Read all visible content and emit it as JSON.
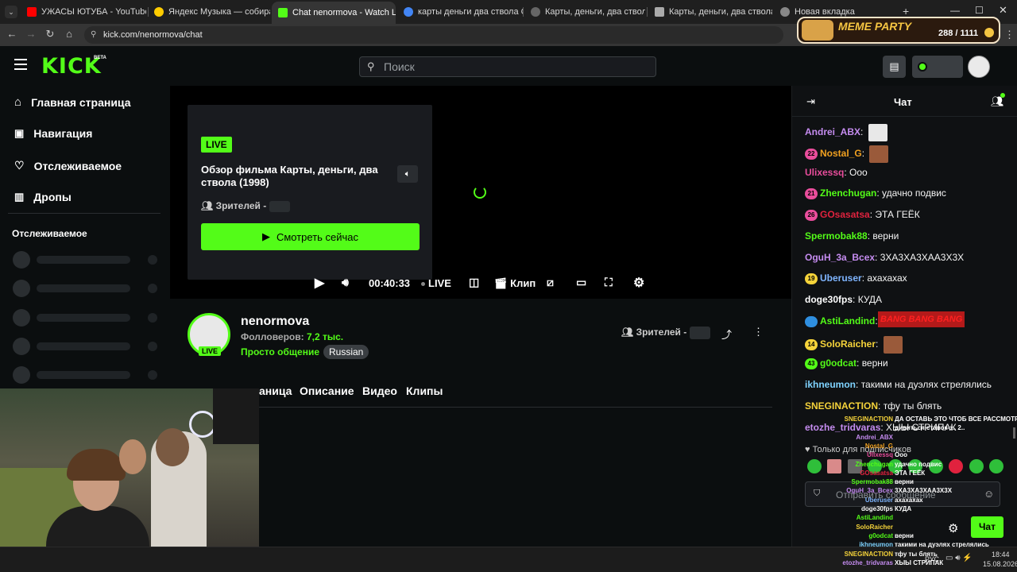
{
  "browser": {
    "tabs": [
      {
        "label": "УЖАСЫ ЮТУБА - YouTube",
        "color": "#ff0000"
      },
      {
        "label": "Яндекс Музыка — собираем...",
        "color": "#ffcc00"
      },
      {
        "label": "Chat nenormova - Watch Live o...",
        "color": "#53fc18"
      },
      {
        "label": "карты деньги два ствола СМО...",
        "color": "#4285f4"
      },
      {
        "label": "Карты, деньги, два ствола фи...",
        "color": "#888888"
      },
      {
        "label": "Карты, деньги, два ствола (199...",
        "color": "#aaaaaa"
      },
      {
        "label": "Новая вкладка",
        "color": "#888888"
      }
    ],
    "url": "kick.com/nenormova/chat"
  },
  "meme_party": {
    "title": "MEME PARTY",
    "count": "288 / 1111"
  },
  "header": {
    "logo": "KICK",
    "beta": "BETA",
    "search_placeholder": "Поиск"
  },
  "sidebar": {
    "items": [
      {
        "label": "Главная страница"
      },
      {
        "label": "Навигация"
      },
      {
        "label": "Отслеживаемое"
      },
      {
        "label": "Дропы"
      }
    ],
    "section_title": "Отслеживаемое"
  },
  "player": {
    "live": "LIVE",
    "title": "Обзор фильма Карты, деньги, два ствола (1998)",
    "viewers_label": "Зрителей -",
    "watch_now": "Смотреть сейчас",
    "time": "00:40:33",
    "live_ctrl": "LIVE",
    "clip": "Клип"
  },
  "channel": {
    "name": "nenormova",
    "followers_label": "Фолловеров:",
    "followers_value": "7,2 тыс.",
    "category": "Просто общение",
    "language": "Russian",
    "live_badge": "LIVE",
    "viewers_label": "Зрителей -",
    "tabs": [
      "аница",
      "Описание",
      "Видео",
      "Клипы"
    ]
  },
  "chat": {
    "title": "Чат",
    "messages": [
      {
        "user": "Andrei_ABX",
        "color": "#c58cf0",
        "text": ""
      },
      {
        "user": "Nostal_G",
        "color": "#f0a020",
        "text": "",
        "badge": "22",
        "badge_color": "#e94d9c"
      },
      {
        "user": "Ulixessq",
        "color": "#e94d9c",
        "text": "Ооо"
      },
      {
        "user": "Zhenchugan",
        "color": "#53fc18",
        "text": "удачно подвис",
        "badge": "21",
        "badge_color": "#e94d9c"
      },
      {
        "user": "GOsasatsa",
        "color": "#e0223e",
        "text": "ЭТА ГЕЁК",
        "badge": "26",
        "badge_color": "#e94d9c"
      },
      {
        "user": "Spermobak88",
        "color": "#53fc18",
        "text": "верни"
      },
      {
        "user": "OguH_3a_Bcex",
        "color": "#c58cf0",
        "text": "3ХА3ХА3ХАА3Х3Х"
      },
      {
        "user": "Uberuser",
        "color": "#7fb5ff",
        "text": "ахахахах",
        "badge": "19",
        "badge_color": "#f5d33a"
      },
      {
        "user": "doge30fps",
        "color": "#ffffff",
        "text": "КУДА"
      },
      {
        "user": "AstiLandind",
        "color": "#53fc18",
        "text": "",
        "badge": "",
        "badge_color": "#2f8fe0"
      },
      {
        "user": "SoloRaicher",
        "color": "#f5d33a",
        "text": "",
        "badge": "14",
        "badge_color": "#f5d33a"
      },
      {
        "user": "g0odcat",
        "color": "#53fc18",
        "text": "верни",
        "badge": "43",
        "badge_color": "#53fc18"
      },
      {
        "user": "ikhneumon",
        "color": "#7fd3ff",
        "text": "такими на дуэлях стрелялись"
      },
      {
        "user": "SNEGINACTION",
        "color": "#f5d33a",
        "text": "тфу ты блять"
      },
      {
        "user": "etozhe_tridvaras",
        "color": "#c58cf0",
        "text": "ХЫЫ СТРИПАК"
      }
    ],
    "emote_banner": "BANG BANG BANG",
    "subs_only": "Только для подписчиков",
    "input_placeholder": "Отправить сообщение",
    "send_label": "Чат"
  },
  "overlay_chat": [
    {
      "user": "SNEGINACTION",
      "color": "#f5d33a",
      "text": "ДА ОСТАВЬ ЭТО ЧТОБ ВСЕ РАССМОТРЕЛИ"
    },
    {
      "user": "",
      "color": "#ffffff",
      "text": "дивиться ставок з.. 2.."
    },
    {
      "user": "Andrei_ABX",
      "color": "#c58cf0",
      "text": ""
    },
    {
      "user": "Nostal_G",
      "color": "#f0a020",
      "text": ""
    },
    {
      "user": "Ulixessq",
      "color": "#e94d9c",
      "text": "Ооо"
    },
    {
      "user": "Zhenchugan",
      "color": "#53fc18",
      "text": "удачно подвис"
    },
    {
      "user": "GOsasatsa",
      "color": "#e0223e",
      "text": "ЭТА ГЕЁК"
    },
    {
      "user": "Spermobak88",
      "color": "#53fc18",
      "text": "верни"
    },
    {
      "user": "OguH_3a_Bcex",
      "color": "#c58cf0",
      "text": "3ХА3ХА3ХАА3Х3Х"
    },
    {
      "user": "Uberuser",
      "color": "#7fb5ff",
      "text": "ахахахах"
    },
    {
      "user": "doge30fps",
      "color": "#ffffff",
      "text": "КУДА"
    },
    {
      "user": "AstiLandind",
      "color": "#53fc18",
      "text": ""
    },
    {
      "user": "SoloRaicher",
      "color": "#f5d33a",
      "text": ""
    },
    {
      "user": "g0odcat",
      "color": "#53fc18",
      "text": "верни"
    },
    {
      "user": "ikhneumon",
      "color": "#7fd3ff",
      "text": "такими на дуэлях стрелялись"
    },
    {
      "user": "SNEGINACTION",
      "color": "#f5d33a",
      "text": "тфу ты блять"
    },
    {
      "user": "etozhe_tridvaras",
      "color": "#c58cf0",
      "text": "ХЫЫ СТРИПАК"
    }
  ],
  "taskbar": {
    "lang": "РУС",
    "time": "18:44",
    "date": "15.08.2026"
  },
  "colors": {
    "accent": "#53fc18",
    "bg": "#0b0e0f",
    "panel": "#191b1f"
  }
}
